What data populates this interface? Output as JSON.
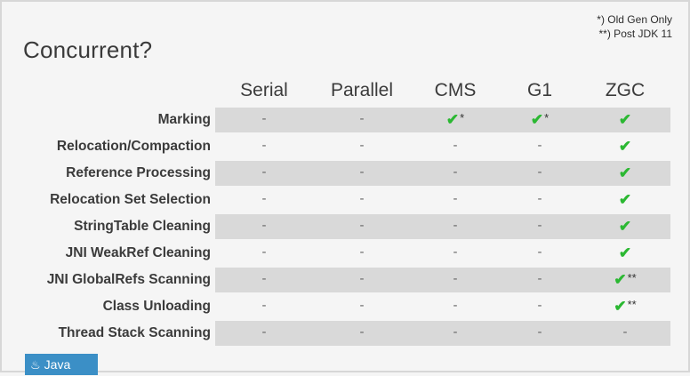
{
  "slide": {
    "title": "Concurrent?",
    "footnotes": [
      "*) Old Gen Only",
      "**) Post JDK 11"
    ]
  },
  "table": {
    "columns": [
      "Serial",
      "Parallel",
      "CMS",
      "G1",
      "ZGC"
    ],
    "rows": [
      {
        "label": "Marking",
        "cells": [
          "-",
          "-",
          "✔*",
          "✔*",
          "✔"
        ]
      },
      {
        "label": "Relocation/Compaction",
        "cells": [
          "-",
          "-",
          "-",
          "-",
          "✔"
        ]
      },
      {
        "label": "Reference Processing",
        "cells": [
          "-",
          "-",
          "-",
          "-",
          "✔"
        ]
      },
      {
        "label": "Relocation Set Selection",
        "cells": [
          "-",
          "-",
          "-",
          "-",
          "✔"
        ]
      },
      {
        "label": "StringTable Cleaning",
        "cells": [
          "-",
          "-",
          "-",
          "-",
          "✔"
        ]
      },
      {
        "label": "JNI WeakRef Cleaning",
        "cells": [
          "-",
          "-",
          "-",
          "-",
          "✔"
        ]
      },
      {
        "label": "JNI GlobalRefs Scanning",
        "cells": [
          "-",
          "-",
          "-",
          "-",
          "✔**"
        ]
      },
      {
        "label": "Class Unloading",
        "cells": [
          "-",
          "-",
          "-",
          "-",
          "✔**"
        ]
      },
      {
        "label": "Thread Stack Scanning",
        "cells": [
          "-",
          "-",
          "-",
          "-",
          "-"
        ]
      }
    ]
  },
  "logo": {
    "text": "Java",
    "icon": "java-cup-icon"
  }
}
